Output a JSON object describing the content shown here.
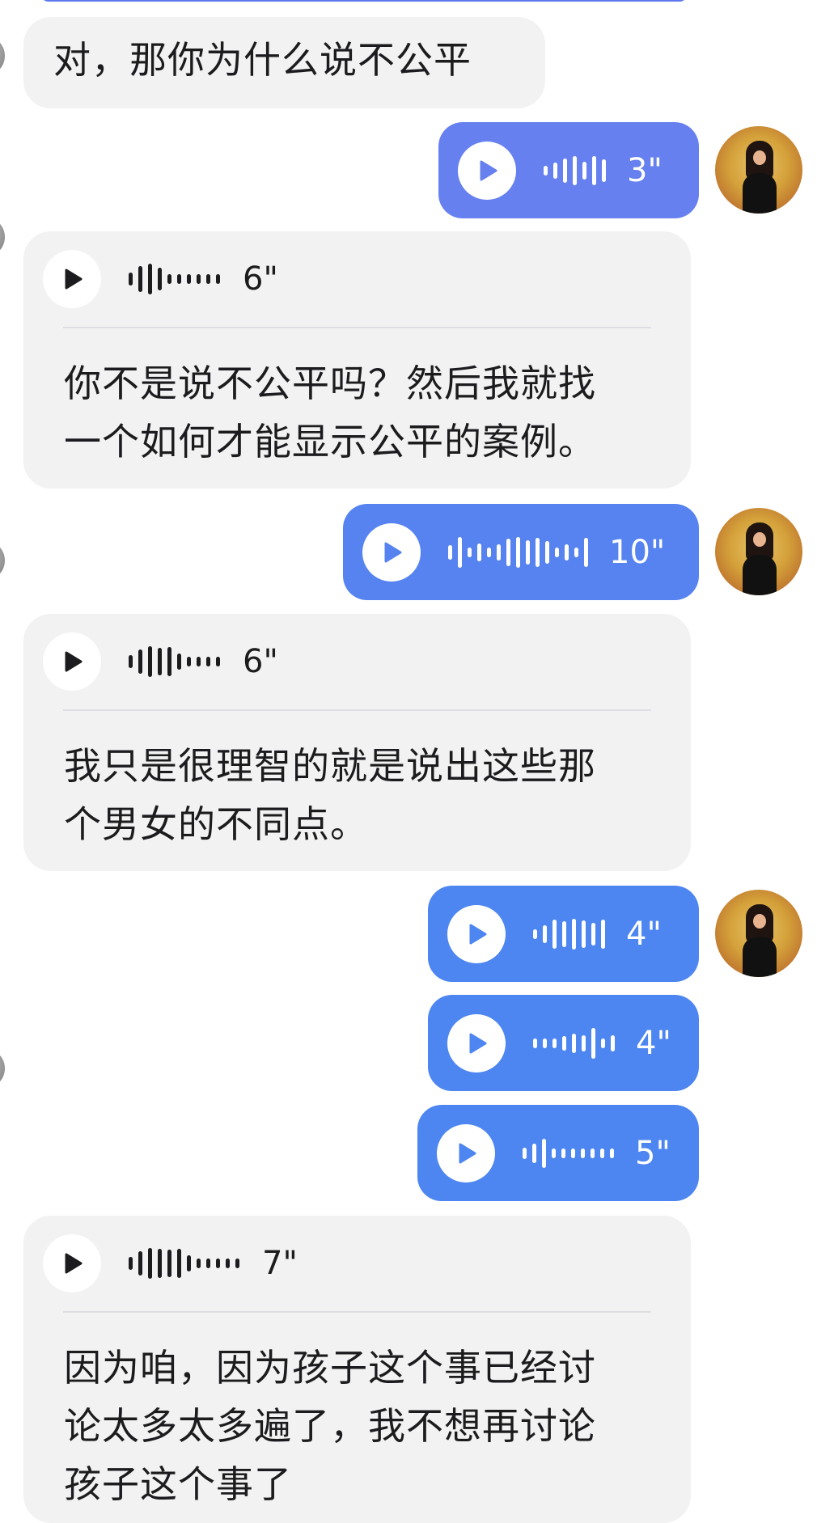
{
  "theme": {
    "incoming_bubble": "#f2f2f3",
    "outgoing_bubble": "#4d86f1",
    "text": "#1c1c1e",
    "divider": "#dedee2"
  },
  "messages": [
    {
      "direction": "incoming",
      "kind": "text",
      "text": "对，那你为什么说不公平"
    },
    {
      "direction": "outgoing",
      "kind": "voice",
      "duration": "3\"",
      "waveform": [
        0.3,
        0.5,
        0.75,
        0.9,
        0.55,
        0.9,
        0.7
      ]
    },
    {
      "direction": "incoming",
      "kind": "voice",
      "duration": "6\"",
      "waveform": [
        0.4,
        0.8,
        0.95,
        0.7,
        0.3,
        0.3,
        0.3,
        0.3,
        0.3,
        0.3
      ],
      "transcript": [
        "你不是说不公平吗？然后我就找",
        "一个如何才能显示公平的案例。"
      ]
    },
    {
      "direction": "outgoing",
      "kind": "voice",
      "duration": "10\"",
      "waveform": [
        0.45,
        0.95,
        0.3,
        0.55,
        0.3,
        0.5,
        0.85,
        0.95,
        0.75,
        0.9,
        0.7,
        0.3,
        0.5,
        0.3,
        0.9
      ]
    },
    {
      "direction": "incoming",
      "kind": "voice",
      "duration": "6\"",
      "waveform": [
        0.4,
        0.75,
        0.95,
        0.85,
        0.9,
        0.5,
        0.3,
        0.3,
        0.3,
        0.3
      ],
      "transcript": [
        "我只是很理智的就是说出这些那",
        "个男女的不同点。"
      ]
    },
    {
      "direction": "outgoing",
      "kind": "voice",
      "duration": "4\"",
      "waveform": [
        0.3,
        0.55,
        0.9,
        0.8,
        0.95,
        0.85,
        0.7,
        0.9
      ]
    },
    {
      "direction": "outgoing",
      "kind": "voice",
      "duration": "4\"",
      "waveform": [
        0.3,
        0.3,
        0.3,
        0.45,
        0.6,
        0.5,
        0.95,
        0.3,
        0.5
      ]
    },
    {
      "direction": "outgoing",
      "kind": "voice",
      "duration": "5\"",
      "waveform": [
        0.35,
        0.6,
        0.9,
        0.3,
        0.3,
        0.3,
        0.3,
        0.3,
        0.3,
        0.3
      ]
    },
    {
      "direction": "incoming",
      "kind": "voice",
      "duration": "7\"",
      "waveform": [
        0.4,
        0.75,
        0.95,
        0.9,
        0.85,
        0.9,
        0.5,
        0.3,
        0.3,
        0.3,
        0.3,
        0.3
      ],
      "transcript": [
        "因为咱，因为孩子这个事已经讨",
        "论太多太多遍了，我不想再讨论",
        "孩子这个事了"
      ]
    }
  ]
}
